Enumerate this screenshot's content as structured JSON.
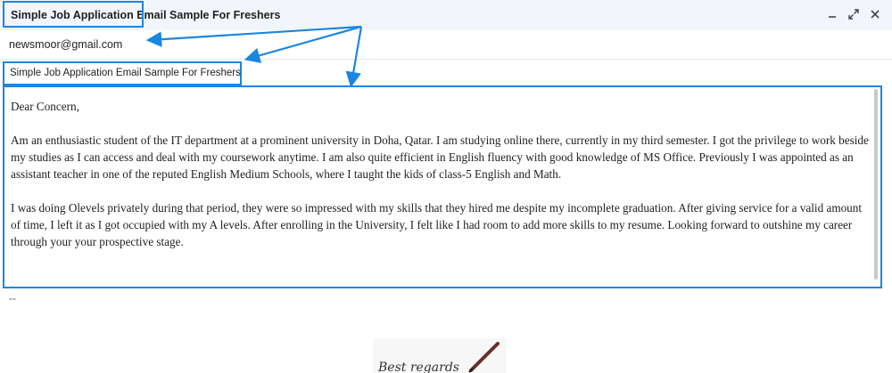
{
  "window": {
    "title": "Simple Job Application Email Sample For Freshers",
    "controls": [
      "minimize-icon",
      "popout-icon",
      "close-icon"
    ]
  },
  "compose": {
    "recipient": "newsmoor@gmail.com",
    "subject": "Simple Job Application Email Sample For Freshers",
    "body": {
      "greeting": "Dear Concern,",
      "paragraph1": "Am an enthusiastic student of the IT department at a prominent university in Doha, Qatar. I am studying online there, currently in my third semester. I got the privilege to work beside my studies as I can access and deal with my coursework anytime. I am also quite efficient in English fluency with good knowledge of MS Office. Previously I was appointed as an assistant teacher in one of the reputed English Medium Schools, where I taught the kids of class-5 English and Math.",
      "paragraph2": "I was doing Olevels privately during that period, they were so impressed with my skills that they hired me despite my incomplete graduation. After giving service for a valid amount of time, I left it as I got occupied with my A levels. After enrolling in the University, I felt like I had room to add more skills to my resume.  Looking forward to outshine my career through your your prospective stage."
    },
    "signature_separator": "--",
    "signature_text": "Best regards"
  },
  "colors": {
    "highlight": "#1a86e0",
    "titlebar_bg": "#f2f6fc"
  }
}
